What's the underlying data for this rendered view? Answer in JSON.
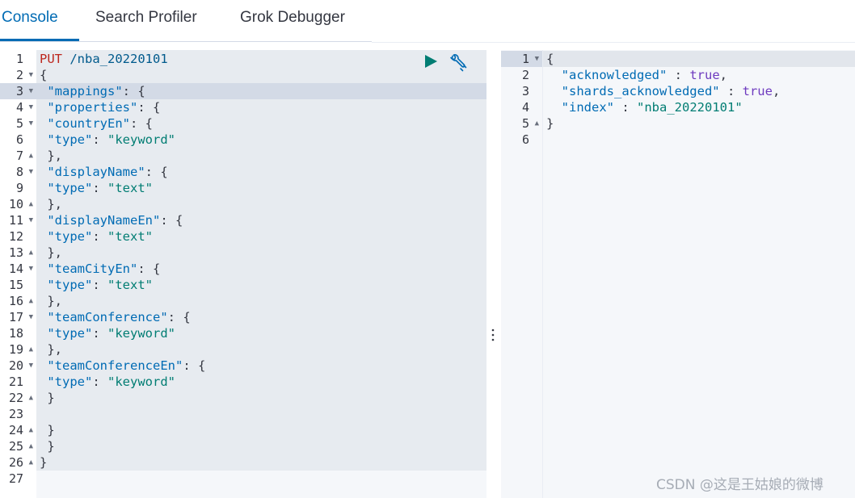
{
  "tabs": [
    {
      "label": "Console",
      "active": true
    },
    {
      "label": "Search Profiler",
      "active": false
    },
    {
      "label": "Grok Debugger",
      "active": false
    }
  ],
  "request": {
    "method": "PUT",
    "path": "/nba_20220101",
    "lines": [
      {
        "n": "1",
        "fold": "",
        "tokens": [
          [
            "method",
            "PUT"
          ],
          [
            "punc",
            " "
          ],
          [
            "url",
            "/nba_20220101"
          ]
        ]
      },
      {
        "n": "2",
        "fold": "▼",
        "tokens": [
          [
            "punc",
            "{"
          ]
        ]
      },
      {
        "n": "3",
        "fold": "▼",
        "hl": true,
        "tokens": [
          [
            "punc",
            " "
          ],
          [
            "key",
            "\"mappings\""
          ],
          [
            "punc",
            ": {"
          ]
        ]
      },
      {
        "n": "4",
        "fold": "▼",
        "tokens": [
          [
            "punc",
            " "
          ],
          [
            "key",
            "\"properties\""
          ],
          [
            "punc",
            ": {"
          ]
        ]
      },
      {
        "n": "5",
        "fold": "▼",
        "tokens": [
          [
            "punc",
            " "
          ],
          [
            "key",
            "\"countryEn\""
          ],
          [
            "punc",
            ": {"
          ]
        ]
      },
      {
        "n": "6",
        "fold": "",
        "tokens": [
          [
            "punc",
            " "
          ],
          [
            "key",
            "\"type\""
          ],
          [
            "punc",
            ": "
          ],
          [
            "str",
            "\"keyword\""
          ]
        ]
      },
      {
        "n": "7",
        "fold": "▲",
        "tokens": [
          [
            "punc",
            " },"
          ]
        ]
      },
      {
        "n": "8",
        "fold": "▼",
        "tokens": [
          [
            "punc",
            " "
          ],
          [
            "key",
            "\"displayName\""
          ],
          [
            "punc",
            ": {"
          ]
        ]
      },
      {
        "n": "9",
        "fold": "",
        "tokens": [
          [
            "punc",
            " "
          ],
          [
            "key",
            "\"type\""
          ],
          [
            "punc",
            ": "
          ],
          [
            "str",
            "\"text\""
          ]
        ]
      },
      {
        "n": "10",
        "fold": "▲",
        "tokens": [
          [
            "punc",
            " },"
          ]
        ]
      },
      {
        "n": "11",
        "fold": "▼",
        "tokens": [
          [
            "punc",
            " "
          ],
          [
            "key",
            "\"displayNameEn\""
          ],
          [
            "punc",
            ": {"
          ]
        ]
      },
      {
        "n": "12",
        "fold": "",
        "tokens": [
          [
            "punc",
            " "
          ],
          [
            "key",
            "\"type\""
          ],
          [
            "punc",
            ": "
          ],
          [
            "str",
            "\"text\""
          ]
        ]
      },
      {
        "n": "13",
        "fold": "▲",
        "tokens": [
          [
            "punc",
            " },"
          ]
        ]
      },
      {
        "n": "14",
        "fold": "▼",
        "tokens": [
          [
            "punc",
            " "
          ],
          [
            "key",
            "\"teamCityEn\""
          ],
          [
            "punc",
            ": {"
          ]
        ]
      },
      {
        "n": "15",
        "fold": "",
        "tokens": [
          [
            "punc",
            " "
          ],
          [
            "key",
            "\"type\""
          ],
          [
            "punc",
            ": "
          ],
          [
            "str",
            "\"text\""
          ]
        ]
      },
      {
        "n": "16",
        "fold": "▲",
        "tokens": [
          [
            "punc",
            " },"
          ]
        ]
      },
      {
        "n": "17",
        "fold": "▼",
        "tokens": [
          [
            "punc",
            " "
          ],
          [
            "key",
            "\"teamConference\""
          ],
          [
            "punc",
            ": {"
          ]
        ]
      },
      {
        "n": "18",
        "fold": "",
        "tokens": [
          [
            "punc",
            " "
          ],
          [
            "key",
            "\"type\""
          ],
          [
            "punc",
            ": "
          ],
          [
            "str",
            "\"keyword\""
          ]
        ]
      },
      {
        "n": "19",
        "fold": "▲",
        "tokens": [
          [
            "punc",
            " },"
          ]
        ]
      },
      {
        "n": "20",
        "fold": "▼",
        "tokens": [
          [
            "punc",
            " "
          ],
          [
            "key",
            "\"teamConferenceEn\""
          ],
          [
            "punc",
            ": {"
          ]
        ]
      },
      {
        "n": "21",
        "fold": "",
        "tokens": [
          [
            "punc",
            " "
          ],
          [
            "key",
            "\"type\""
          ],
          [
            "punc",
            ": "
          ],
          [
            "str",
            "\"keyword\""
          ]
        ]
      },
      {
        "n": "22",
        "fold": "▲",
        "tokens": [
          [
            "punc",
            " }"
          ]
        ]
      },
      {
        "n": "23",
        "fold": "",
        "tokens": []
      },
      {
        "n": "24",
        "fold": "▲",
        "tokens": [
          [
            "punc",
            " }"
          ]
        ]
      },
      {
        "n": "25",
        "fold": "▲",
        "tokens": [
          [
            "punc",
            " }"
          ]
        ]
      },
      {
        "n": "26",
        "fold": "▲",
        "tokens": [
          [
            "punc",
            "}"
          ]
        ]
      },
      {
        "n": "27",
        "fold": "",
        "tokens": []
      }
    ]
  },
  "response": {
    "lines": [
      {
        "n": "1",
        "fold": "▼",
        "hl": true,
        "tokens": [
          [
            "punc",
            "{"
          ]
        ]
      },
      {
        "n": "2",
        "fold": "",
        "tokens": [
          [
            "punc",
            "  "
          ],
          [
            "key",
            "\"acknowledged\""
          ],
          [
            "punc",
            " : "
          ],
          [
            "bool",
            "true"
          ],
          [
            "punc",
            ","
          ]
        ]
      },
      {
        "n": "3",
        "fold": "",
        "tokens": [
          [
            "punc",
            "  "
          ],
          [
            "key",
            "\"shards_acknowledged\""
          ],
          [
            "punc",
            " : "
          ],
          [
            "bool",
            "true"
          ],
          [
            "punc",
            ","
          ]
        ]
      },
      {
        "n": "4",
        "fold": "",
        "tokens": [
          [
            "punc",
            "  "
          ],
          [
            "key",
            "\"index\""
          ],
          [
            "punc",
            " : "
          ],
          [
            "str",
            "\"nba_20220101\""
          ]
        ]
      },
      {
        "n": "5",
        "fold": "▲",
        "tokens": [
          [
            "punc",
            "}"
          ]
        ]
      },
      {
        "n": "6",
        "fold": "",
        "tokens": []
      }
    ]
  },
  "icons": {
    "run": "play-icon",
    "settings": "wrench-icon",
    "resizer": "vertical-dots-icon"
  },
  "colors": {
    "accent": "#006bb4",
    "run": "#017d73",
    "method": "#bd271e",
    "string": "#017d73",
    "key": "#006bb4"
  },
  "watermark": "CSDN @这是王姑娘的微博"
}
